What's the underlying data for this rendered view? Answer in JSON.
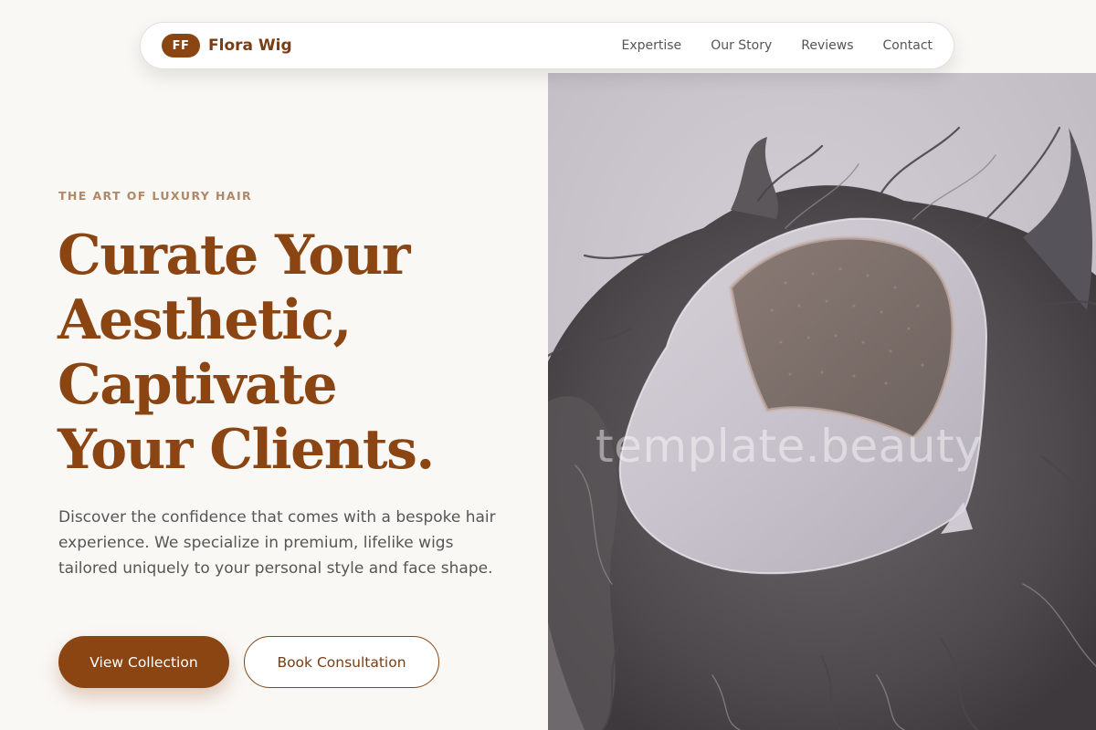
{
  "nav": {
    "logo_initials": "FF",
    "brand_name": "Flora Wig",
    "links": [
      "Expertise",
      "Our Story",
      "Reviews",
      "Contact"
    ]
  },
  "hero": {
    "eyebrow": "THE ART OF LUXURY HAIR",
    "headline_lines": [
      "Curate Your",
      "Aesthetic,",
      "Captivate",
      "Your Clients."
    ],
    "description": "Discover the confidence that comes with a bespoke hair experience. We specialize in premium, lifelike wigs tailored uniquely to your personal style and face shape.",
    "primary_button": "View Collection",
    "secondary_button": "Book Consultation"
  },
  "image": {
    "watermark": "template.beauty",
    "subject": "hair-system-photo"
  },
  "colors": {
    "accent": "#8b4513",
    "background": "#faf8f5",
    "eyebrow": "#b08868",
    "body_text": "#565656",
    "photo_background": "#cac5cc"
  }
}
